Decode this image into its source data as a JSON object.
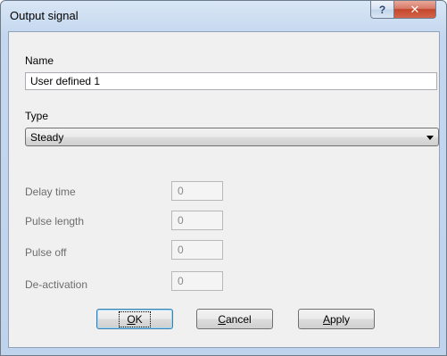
{
  "window": {
    "title": "Output signal",
    "help_glyph": "?",
    "close_glyph": "✕"
  },
  "form": {
    "name_label": "Name",
    "name_value": "User defined 1",
    "type_label": "Type",
    "type_value": "Steady",
    "fields": [
      {
        "label": "Delay time",
        "value": "0"
      },
      {
        "label": "Pulse length",
        "value": "0"
      },
      {
        "label": "Pulse off",
        "value": "0"
      },
      {
        "label": "De-activation",
        "value": "0"
      }
    ]
  },
  "buttons": {
    "ok": {
      "mnemonic": "O",
      "rest": "K"
    },
    "cancel": {
      "mnemonic": "C",
      "rest": "ancel"
    },
    "apply": {
      "mnemonic": "A",
      "rest": "pply"
    }
  }
}
